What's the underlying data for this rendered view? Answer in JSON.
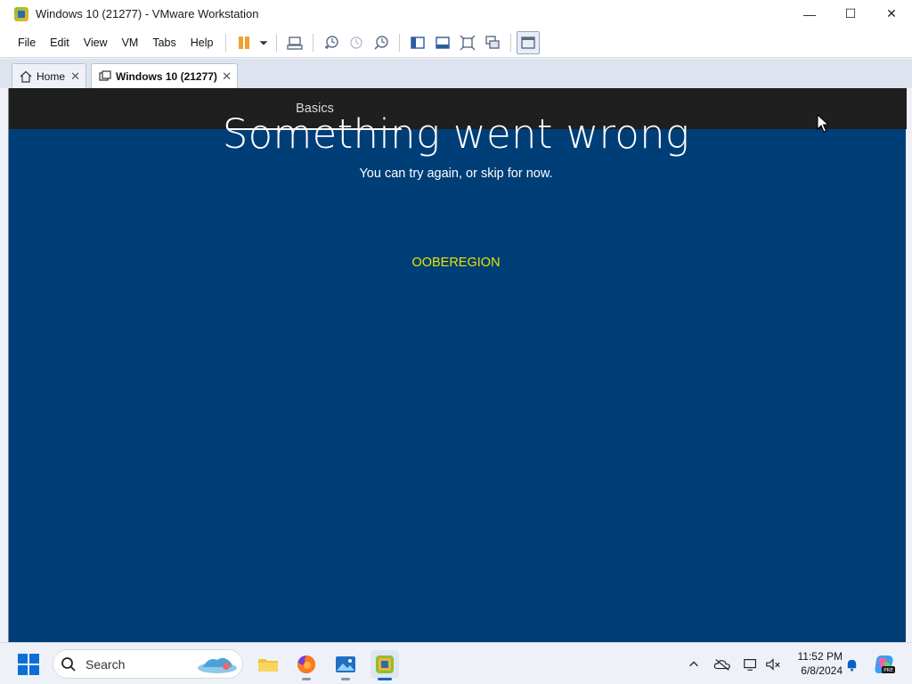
{
  "window": {
    "title": "Windows 10 (21277) - VMware Workstation",
    "minimize_glyph": "—",
    "maximize_glyph": "☐",
    "close_glyph": "✕"
  },
  "menu": {
    "items": [
      "File",
      "Edit",
      "View",
      "VM",
      "Tabs",
      "Help"
    ]
  },
  "toolbar": {
    "icons": [
      "pause-icon",
      "dropdown-icon",
      "send-ctrl-alt-del-icon",
      "snapshot-take-icon",
      "snapshot-revert-icon",
      "snapshot-manager-icon",
      "show-library-icon",
      "thumbnail-bar-icon",
      "full-screen-icon",
      "unity-icon",
      "console-view-icon"
    ]
  },
  "tabs": [
    {
      "label": "Home",
      "icon": "home-icon",
      "active": false
    },
    {
      "label": "Windows 10 (21277)",
      "icon": "vm-icon",
      "active": true
    }
  ],
  "oobe": {
    "nav_label": "Basics",
    "heading": "Something went wrong",
    "subtitle": "You can try again, or skip for now.",
    "error_code": "OOBEREGION",
    "background": "#003e77",
    "code_color": "#e6e600"
  },
  "taskbar": {
    "search_placeholder": "Search",
    "apps": [
      "file-explorer-icon",
      "firefox-icon",
      "photos-icon",
      "vmware-workstation-icon"
    ],
    "time": "11:52 PM",
    "date": "6/8/2024"
  },
  "colors": {
    "accent": "#0067c0",
    "oobe_header": "#1f1f1f"
  }
}
